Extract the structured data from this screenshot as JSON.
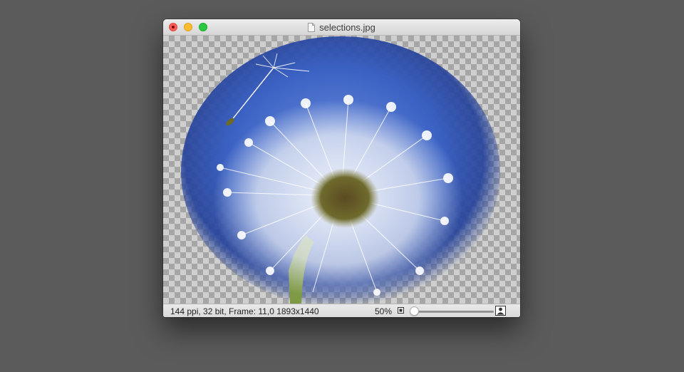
{
  "window": {
    "title": "selections.jpg"
  },
  "status_bar": {
    "info": "144 ppi, 32 bit, Frame: 11,0 1893x1440",
    "zoom": "50%",
    "zoom_fraction": 0.0
  },
  "canvas": {
    "content": "dandelion-photo",
    "background": "transparency-checkerboard",
    "sky_color": "#3b62c4"
  },
  "icons": {
    "close": "close-icon",
    "minimize": "minimize-icon",
    "zoom": "zoom-icon",
    "document": "document-icon",
    "zoom_out": "small-image-icon",
    "zoom_in": "large-image-icon"
  }
}
